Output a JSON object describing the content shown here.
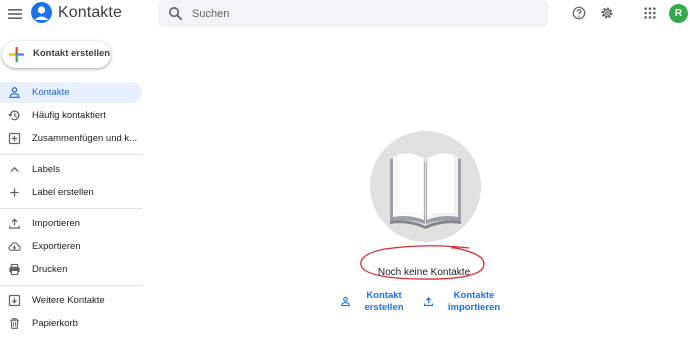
{
  "app": {
    "title": "Kontakte"
  },
  "search": {
    "placeholder": "Suchen"
  },
  "user": {
    "avatar_letter": "R",
    "avatar_color": "#33ab4b"
  },
  "sidebar": {
    "create_label": "Kontakt erstellen",
    "items": [
      {
        "label": "Kontakte",
        "icon": "person-icon",
        "active": true
      },
      {
        "label": "Häufig kontaktiert",
        "icon": "history-icon"
      },
      {
        "label": "Zusammenfügen und k...",
        "icon": "merge-icon"
      },
      {
        "label": "Labels",
        "icon": "chevron-up-icon"
      },
      {
        "label": "Label erstellen",
        "icon": "plus-icon"
      },
      {
        "label": "Importieren",
        "icon": "upload-icon"
      },
      {
        "label": "Exportieren",
        "icon": "cloud-download-icon"
      },
      {
        "label": "Drucken",
        "icon": "printer-icon"
      },
      {
        "label": "Weitere Kontakte",
        "icon": "archive-person-icon"
      },
      {
        "label": "Papierkorb",
        "icon": "trash-icon"
      }
    ]
  },
  "main": {
    "empty_text": "Noch keine Kontakte",
    "actions": {
      "create_line1": "Kontakt",
      "create_line2": "erstellen",
      "import_line1": "Kontakte",
      "import_line2": "importieren"
    }
  },
  "colors": {
    "accent": "#1a73e8",
    "active_bg": "#e8f0fe",
    "annotation": "#d32f2f"
  }
}
